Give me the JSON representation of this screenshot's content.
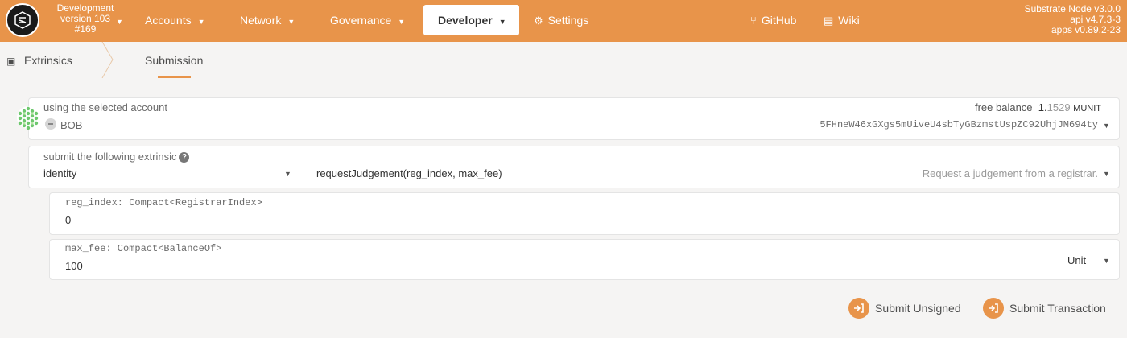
{
  "header": {
    "chain_name": "Development",
    "chain_version": "version 103",
    "chain_block": "#169",
    "nav": [
      {
        "label": "Accounts"
      },
      {
        "label": "Network"
      },
      {
        "label": "Governance"
      },
      {
        "label": "Developer"
      },
      {
        "label": "Settings"
      },
      {
        "label": "GitHub"
      },
      {
        "label": "Wiki"
      }
    ],
    "node_version": "Substrate Node v3.0.0",
    "api_version": "api v4.7.3-3",
    "apps_version": "apps v0.89.2-23"
  },
  "subnav": {
    "root": "Extrinsics",
    "tab": "Submission"
  },
  "account": {
    "label": "using the selected account",
    "name": "BOB",
    "balance_label": "free balance",
    "balance_int": "1.",
    "balance_frac": "1529",
    "balance_unit": "MUNIT",
    "address": "5FHneW46xGXgs5mUiveU4sbTyGBzmstUspZC92UhjJM694ty"
  },
  "extrinsic": {
    "label": "submit the following extrinsic",
    "module": "identity",
    "method": "requestJudgement(reg_index, max_fee)",
    "description": "Request a judgement from a registrar."
  },
  "params": [
    {
      "label": "reg_index: Compact<RegistrarIndex>",
      "value": "0"
    },
    {
      "label": "max_fee: Compact<BalanceOf>",
      "value": "100",
      "unit": "Unit"
    }
  ],
  "actions": {
    "submit_unsigned": "Submit Unsigned",
    "submit_transaction": "Submit Transaction"
  },
  "colors": {
    "accent": "#e8944a",
    "background": "#f5f4f3"
  }
}
